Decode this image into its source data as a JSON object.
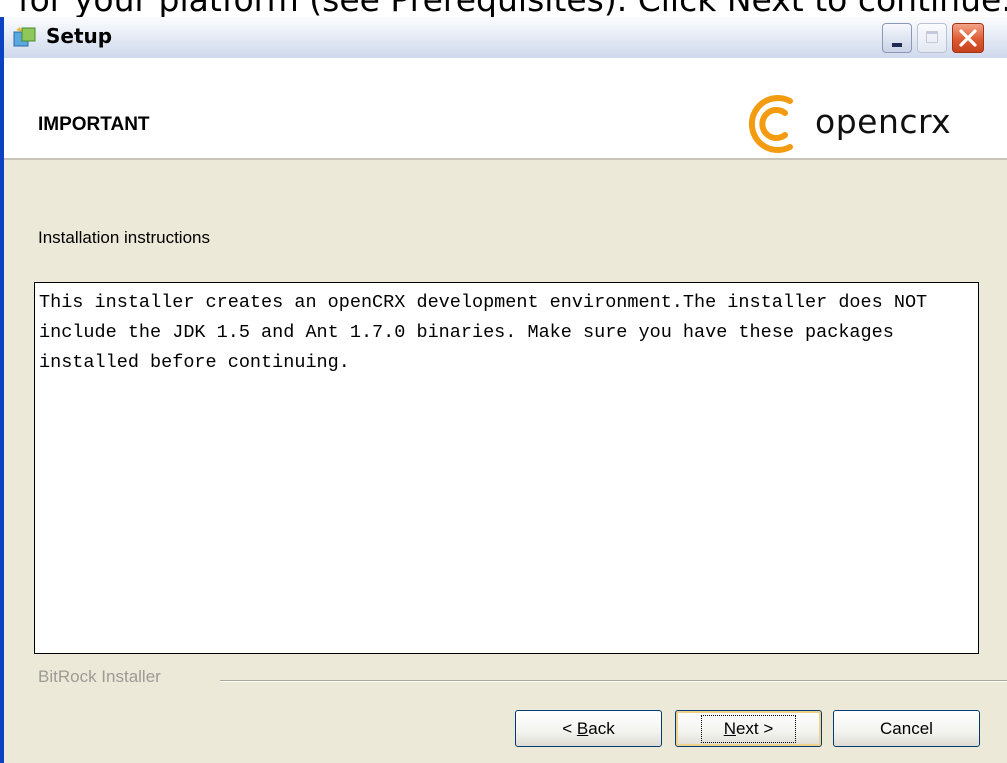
{
  "background_text": "for your platform (see Prerequisites). Click Next to continue.",
  "window": {
    "title": "Setup",
    "controls": [
      "minimize",
      "maximize",
      "close"
    ]
  },
  "header": {
    "title": "IMPORTANT",
    "logo_text": "opencrx",
    "logo_color": "#f39c12"
  },
  "content": {
    "section_label": "Installation instructions",
    "text": "This installer creates an openCRX development environment.The installer does NOT include the JDK 1.5 and Ant 1.7.0 binaries. Make sure you have these packages installed before continuing."
  },
  "footer": {
    "brand": "BitRock Installer",
    "buttons": {
      "back_prefix": "< ",
      "back_mnemonic": "B",
      "back_rest": "ack",
      "next_mnemonic": "N",
      "next_rest": "ext >",
      "cancel": "Cancel"
    }
  }
}
